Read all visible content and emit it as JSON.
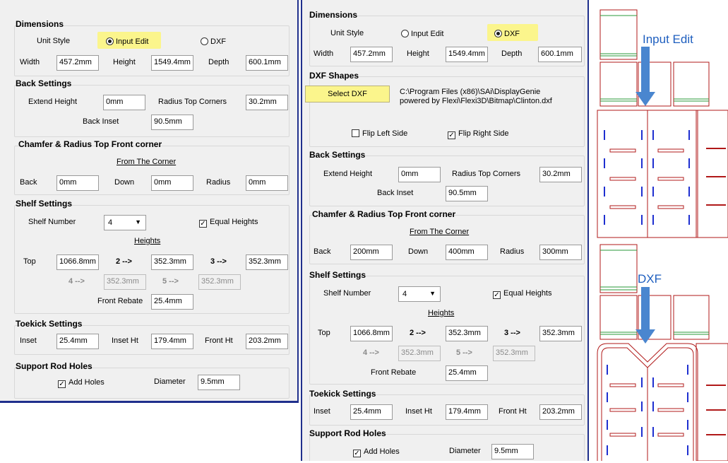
{
  "left": {
    "dimensions": {
      "title": "Dimensions",
      "unit_style_label": "Unit Style",
      "opt_input_edit": "Input Edit",
      "opt_dxf": "DXF",
      "width_label": "Width",
      "width": "457.2mm",
      "height_label": "Height",
      "height": "1549.4mm",
      "depth_label": "Depth",
      "depth": "600.1mm"
    },
    "back": {
      "title": "Back Settings",
      "extend_label": "Extend Height",
      "extend": "0mm",
      "radius_label": "Radius Top Corners",
      "radius": "30.2mm",
      "inset_label": "Back Inset",
      "inset": "90.5mm"
    },
    "chamfer": {
      "title": "Chamfer & Radius Top Front corner",
      "from": "From The Corner",
      "back_label": "Back",
      "back": "0mm",
      "down_label": "Down",
      "down": "0mm",
      "radius_label": "Radius",
      "radius": "0mm"
    },
    "shelf": {
      "title": "Shelf Settings",
      "number_label": "Shelf Number",
      "number": "4",
      "equal": "Equal Heights",
      "heights": "Heights",
      "top_label": "Top",
      "top": "1066.8mm",
      "l2": "2 -->",
      "v2": "352.3mm",
      "l3": "3 -->",
      "v3": "352.3mm",
      "l4": "4 -->",
      "v4": "352.3mm",
      "l5": "5 -->",
      "v5": "352.3mm",
      "rebate_label": "Front Rebate",
      "rebate": "25.4mm"
    },
    "toekick": {
      "title": "Toekick Settings",
      "inset_label": "Inset",
      "inset": "25.4mm",
      "insetht_label": "Inset Ht",
      "insetht": "179.4mm",
      "frontht_label": "Front Ht",
      "frontht": "203.2mm"
    },
    "rod": {
      "title": "Support Rod Holes",
      "add": "Add Holes",
      "dia_label": "Diameter",
      "dia": "9.5mm"
    }
  },
  "right": {
    "dimensions": {
      "title": "Dimensions",
      "unit_style_label": "Unit Style",
      "opt_input_edit": "Input Edit",
      "opt_dxf": "DXF",
      "width_label": "Width",
      "width": "457.2mm",
      "height_label": "Height",
      "height": "1549.4mm",
      "depth_label": "Depth",
      "depth": "600.1mm"
    },
    "dxf": {
      "title": "DXF Shapes",
      "button": "Select DXF",
      "path1": "C:\\Program Files (x86)\\SAi\\DisplayGenie",
      "path2": "powered by Flexi\\Flexi3D\\Bitmap\\Clinton.dxf",
      "flip_left": "Flip Left Side",
      "flip_right": "Flip Right Side"
    },
    "back": {
      "title": "Back Settings",
      "extend_label": "Extend Height",
      "extend": "0mm",
      "radius_label": "Radius Top Corners",
      "radius": "30.2mm",
      "inset_label": "Back Inset",
      "inset": "90.5mm"
    },
    "chamfer": {
      "title": "Chamfer & Radius Top Front corner",
      "from": "From The Corner",
      "back_label": "Back",
      "back": "200mm",
      "down_label": "Down",
      "down": "400mm",
      "radius_label": "Radius",
      "radius": "300mm"
    },
    "shelf": {
      "title": "Shelf Settings",
      "number_label": "Shelf Number",
      "number": "4",
      "equal": "Equal Heights",
      "heights": "Heights",
      "top_label": "Top",
      "top": "1066.8mm",
      "l2": "2 -->",
      "v2": "352.3mm",
      "l3": "3 -->",
      "v3": "352.3mm",
      "l4": "4 -->",
      "v4": "352.3mm",
      "l5": "5 -->",
      "v5": "352.3mm",
      "rebate_label": "Front Rebate",
      "rebate": "25.4mm"
    },
    "toekick": {
      "title": "Toekick Settings",
      "inset_label": "Inset",
      "inset": "25.4mm",
      "insetht_label": "Inset Ht",
      "insetht": "179.4mm",
      "frontht_label": "Front Ht",
      "frontht": "203.2mm"
    },
    "rod": {
      "title": "Support Rod Holes",
      "add": "Add Holes",
      "dia_label": "Diameter",
      "dia": "9.5mm"
    }
  },
  "preview": {
    "caption_top": "Input Edit",
    "caption_bottom": "DXF",
    "arrow_color": "#4a86cf",
    "outline_color": "#b01818",
    "shelf_color": "#2a9a3a",
    "hole_color": "#1e2fd0"
  },
  "colors": {
    "highlight": "#fbf58c",
    "border": "#1f2f8c"
  }
}
